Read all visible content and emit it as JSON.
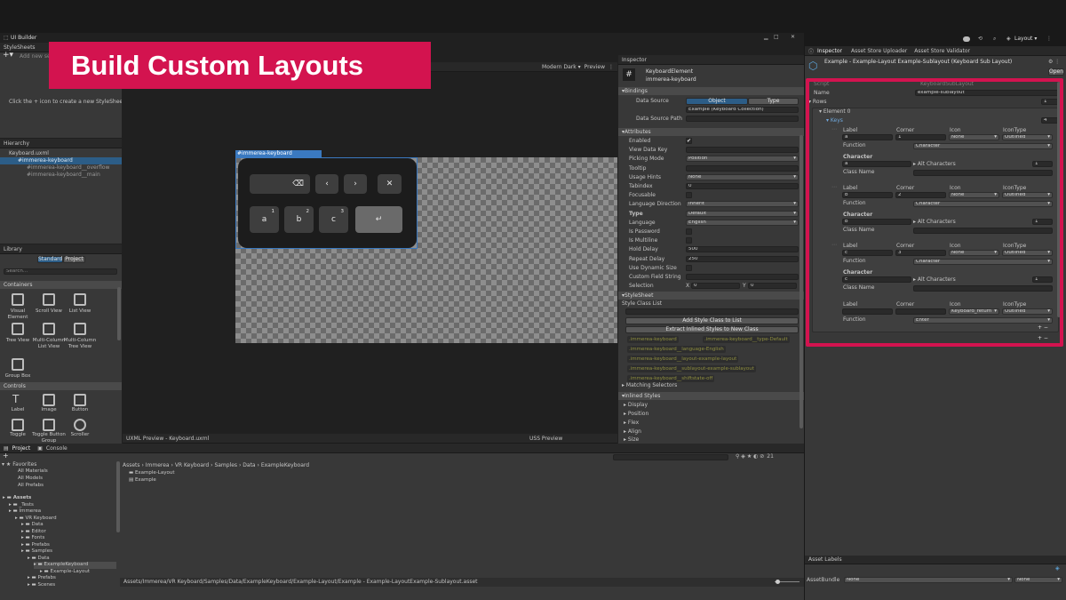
{
  "banner": {
    "title": "Build Custom Layouts"
  },
  "topbar": {
    "layout_label": "Layout"
  },
  "uibuilder": {
    "tab": "UI Builder",
    "stylesheets_header": "StyleSheets",
    "add_new": "Add new selector...",
    "stylesheet_hint": "Click the + icon to create a new StyleSheet.",
    "hierarchy_header": "Hierarchy",
    "hierarchy": [
      "Keyboard.uxml",
      "#immerea-keyboard",
      "#immerea-keyboard__overflow",
      "#immerea-keyboard__main"
    ],
    "library_header": "Library",
    "library_tabs": [
      "Standard",
      "Project"
    ],
    "library_search": "Search...",
    "containers_header": "Containers",
    "containers": [
      "Visual Element",
      "Scroll View",
      "List View",
      "Tree View",
      "Multi-Column List View",
      "Multi-Column Tree View",
      "Group Box"
    ],
    "controls_header": "Controls",
    "controls": [
      "Label",
      "Image",
      "Button",
      "Toggle",
      "Toggle Button Group",
      "Scroller"
    ],
    "theme": "Modern Dark",
    "preview_btn": "Preview",
    "canvas_label": "#immerea-keyboard",
    "uxml_preview": "UXML Preview - Keyboard.uxml",
    "uss_preview": "USS Preview",
    "keys": {
      "backspace": "⌫",
      "left": "‹",
      "right": "›",
      "close": "✕",
      "enter": "↵"
    },
    "letter_keys": [
      {
        "label": "a",
        "sub": "1"
      },
      {
        "label": "b",
        "sub": "2"
      },
      {
        "label": "c",
        "sub": "3"
      }
    ]
  },
  "center_inspector": {
    "title": "Inspector",
    "element_type": "KeyboardElement",
    "element_name": "immerea-keyboard",
    "bindings_header": "Bindings",
    "data_source_label": "Data Source",
    "tabs": [
      "Object",
      "Type"
    ],
    "data_source_value": "Example (Keyboard Collection)",
    "data_source_path_label": "Data Source Path",
    "attributes_header": "Attributes",
    "attributes": [
      {
        "label": "Enabled",
        "kind": "check",
        "value": "✔"
      },
      {
        "label": "View Data Key",
        "kind": "field",
        "value": ""
      },
      {
        "label": "Picking Mode",
        "kind": "dd",
        "value": "Position"
      },
      {
        "label": "Tooltip",
        "kind": "field",
        "value": ""
      },
      {
        "label": "Usage Hints",
        "kind": "dd",
        "value": "None"
      },
      {
        "label": "Tabindex",
        "kind": "field",
        "value": "0"
      },
      {
        "label": "Focusable",
        "kind": "check",
        "value": ""
      },
      {
        "label": "Language Direction",
        "kind": "dd",
        "value": "Inherit"
      },
      {
        "label": "Type",
        "kind": "dd",
        "value": "Default"
      },
      {
        "label": "Language",
        "kind": "dd",
        "value": "English"
      },
      {
        "label": "Is Password",
        "kind": "check",
        "value": ""
      },
      {
        "label": "Is Multiline",
        "kind": "check",
        "value": ""
      },
      {
        "label": "Hold Delay",
        "kind": "field",
        "value": "500"
      },
      {
        "label": "Repeat Delay",
        "kind": "field",
        "value": "250"
      },
      {
        "label": "Use Dynamic Size",
        "kind": "check",
        "value": ""
      },
      {
        "label": "Custom Field String",
        "kind": "field",
        "value": ""
      },
      {
        "label": "Selection",
        "kind": "xy",
        "value": ""
      }
    ],
    "selection_x": "0",
    "selection_y": "0",
    "x_label": "X",
    "y_label": "Y",
    "stylesheet_header": "StyleSheet",
    "style_class_list": "Style Class List",
    "add_style_class": "Add Style Class to List",
    "extract_styles": "Extract Inlined Styles to New Class",
    "classes": [
      ".immerea-keyboard",
      ".immerea-keyboard__type-Default",
      ".immerea-keyboard__language-English",
      ".immerea-keyboard__layout-example-layout",
      ".immerea-keyboard__sublayout-example-sublayout",
      ".immerea-keyboard__shiftstate-off"
    ],
    "matching_selectors": "Matching Selectors",
    "inlined_styles": "Inlined Styles",
    "inlined_items": [
      "Display",
      "Position",
      "Flex",
      "Align",
      "Size"
    ]
  },
  "right_inspector": {
    "tabs": [
      "Inspector",
      "Asset Store Uploader",
      "Asset Store Validator"
    ],
    "asset_title": "Example - Example-Layout Example-Sublayout (Keyboard Sub Layout)",
    "open_btn": "Open",
    "script_label": "Script",
    "script_value": "KeyboardSubLayout",
    "name_label": "Name",
    "name_value": "example-sublayout",
    "rows_label": "Rows",
    "rows_count": "1",
    "element0": "Element 0",
    "keys_label": "Keys",
    "keys_count": "4",
    "col_headers": [
      "Label",
      "Corner",
      "Icon",
      "IconType"
    ],
    "function_label": "Function",
    "character_label": "Character",
    "alt_characters": "Alt Characters",
    "class_name": "Class Name",
    "key_entries": [
      {
        "label": "a",
        "corner": "1",
        "icon": "None",
        "icontype": "Outlined",
        "function": "Character",
        "character": "a",
        "alt": "1"
      },
      {
        "label": "b",
        "corner": "2",
        "icon": "None",
        "icontype": "Outlined",
        "function": "Character",
        "character": "b",
        "alt": "1"
      },
      {
        "label": "c",
        "corner": "3",
        "icon": "None",
        "icontype": "Outlined",
        "function": "Character",
        "character": "c",
        "alt": "1"
      }
    ],
    "last_key": {
      "label": "",
      "corner": "",
      "icon": "Keyboard_return",
      "icontype": "Outlined",
      "function": "Enter"
    },
    "asset_labels": "Asset Labels",
    "assetbundle_label": "AssetBundle",
    "assetbundle_value": "None",
    "assetvariant_value": "None"
  },
  "project": {
    "tabs": [
      "Project",
      "Console"
    ],
    "favorites": "Favorites",
    "fav_items": [
      "All Materials",
      "All Models",
      "All Prefabs"
    ],
    "tree": [
      {
        "label": "Assets",
        "lvl": 0
      },
      {
        "label": "_Tests",
        "lvl": 1
      },
      {
        "label": "Immerea",
        "lvl": 1
      },
      {
        "label": "VR Keyboard",
        "lvl": 2
      },
      {
        "label": "Data",
        "lvl": 3
      },
      {
        "label": "Editor",
        "lvl": 3
      },
      {
        "label": "Fonts",
        "lvl": 3
      },
      {
        "label": "Prefabs",
        "lvl": 3
      },
      {
        "label": "Samples",
        "lvl": 3
      },
      {
        "label": "Data",
        "lvl": 4
      },
      {
        "label": "ExampleKeyboard",
        "lvl": 5
      },
      {
        "label": "Example-Layout",
        "lvl": 6
      },
      {
        "label": "Prefabs",
        "lvl": 4
      },
      {
        "label": "Scenes",
        "lvl": 4
      }
    ],
    "breadcrumb": [
      "Assets",
      "Immerea",
      "VR Keyboard",
      "Samples",
      "Data",
      "ExampleKeyboard"
    ],
    "files": [
      "Example-Layout",
      "Example"
    ],
    "status_path": "Assets/Immerea/VR Keyboard/Samples/Data/ExampleKeyboard/Example-Layout/Example - Example-LayoutExample-Sublayout.asset",
    "hidden_count": "21"
  }
}
